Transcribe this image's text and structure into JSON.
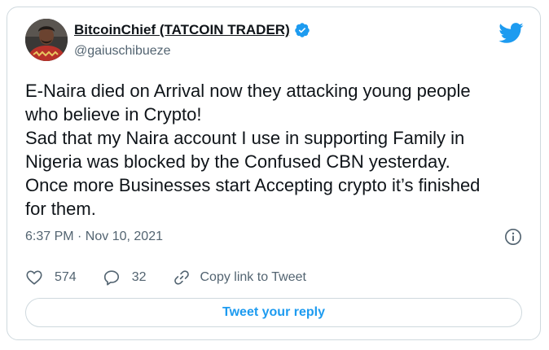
{
  "author": {
    "display_name": "BitcoinChief (TATCOIN TRADER)",
    "handle": "@gaiuschibueze",
    "avatar_icon": "profile-photo",
    "verified_icon": "verified-badge-icon"
  },
  "tweet": {
    "lines": [
      "E-Naira died on Arrival now they attacking young people",
      "who believe in Crypto!",
      "Sad that my Naira account I use in supporting Family in",
      "Nigeria was blocked by the Confused CBN yesterday.",
      "Once more Businesses start Accepting crypto it’s finished",
      "for them."
    ],
    "timestamp": "6:37 PM · Nov 10, 2021"
  },
  "actions": {
    "like_count": "574",
    "reply_count": "32",
    "copy_link_label": "Copy link to Tweet"
  },
  "reply_button_label": "Tweet your reply",
  "colors": {
    "brand_blue": "#1d9bf0",
    "text_primary": "#0f1419",
    "text_secondary": "#536471",
    "border": "#cfd9de"
  },
  "icons": {
    "brand": "twitter-bird-icon",
    "info": "info-icon",
    "like": "heart-icon",
    "reply": "comment-icon",
    "copy": "link-icon"
  }
}
